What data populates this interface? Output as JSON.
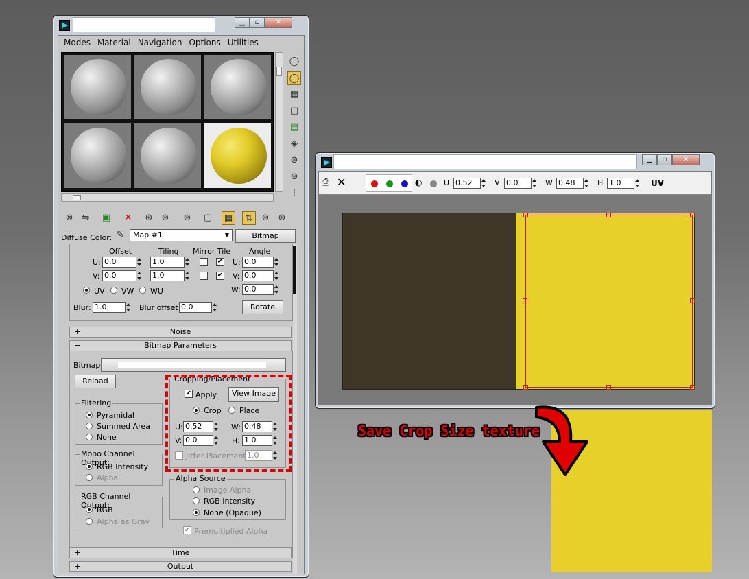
{
  "material_editor": {
    "menu": [
      "Modes",
      "Material",
      "Navigation",
      "Options",
      "Utilities"
    ],
    "diffuse_label": "Diffuse Color:",
    "map_name": "Map #1",
    "map_type": "Bitmap",
    "coords": {
      "offset_label": "Offset",
      "tiling_label": "Tiling",
      "mirror_tile_label": "Mirror Tile",
      "angle_label": "Angle",
      "u_label": "U:",
      "v_label": "V:",
      "w_label": "W:",
      "offset_u": "0.0",
      "offset_v": "0.0",
      "tiling_u": "1.0",
      "tiling_v": "1.0",
      "angle_u": "0.0",
      "angle_v": "0.0",
      "angle_w": "0.0",
      "uv": "UV",
      "vw": "VW",
      "wu": "WU",
      "blur_label": "Blur:",
      "blur": "1.0",
      "blur_offset_label": "Blur offset:",
      "blur_offset": "0.0",
      "rotate": "Rotate"
    },
    "rollouts": {
      "noise": "Noise",
      "bitmap_params": "Bitmap Parameters",
      "time": "Time",
      "output": "Output",
      "plus": "+",
      "minus": "−"
    },
    "bitmap": {
      "label": "Bitmap:",
      "reload": "Reload",
      "filtering": "Filtering",
      "pyramidal": "Pyramidal",
      "summed_area": "Summed Area",
      "none": "None",
      "mono_output": "Mono Channel Output:",
      "rgb_intensity": "RGB Intensity",
      "alpha": "Alpha",
      "rgb_output": "RGB Channel Output:",
      "rgb": "RGB",
      "alpha_as_gray": "Alpha as Gray",
      "cropping": "Cropping/Placement",
      "apply": "Apply",
      "view_image": "View Image",
      "crop": "Crop",
      "place": "Place",
      "crop_u": "0.52",
      "crop_v": "0.0",
      "crop_w": "0.48",
      "crop_h": "1.0",
      "h_label": "H:",
      "jitter": "Jitter Placement:",
      "jitter_val": "1.0",
      "alpha_source": "Alpha Source",
      "image_alpha": "Image Alpha",
      "rgb_intensity2": "RGB Intensity",
      "none_opaque": "None (Opaque)",
      "premultiplied": "Premultiplied Alpha"
    }
  },
  "image_viewer": {
    "u_label": "U",
    "u": "0.52",
    "v_label": "V",
    "v": "0.0",
    "w_label": "W",
    "w": "0.48",
    "h_label": "H",
    "h": "1.0",
    "uv": "UV"
  },
  "annotation": "Save Crop Size texture",
  "colors": {
    "texture_yellow": "#e8d02a",
    "texture_dark": "#3e3626",
    "highlight_red": "#e00000"
  }
}
